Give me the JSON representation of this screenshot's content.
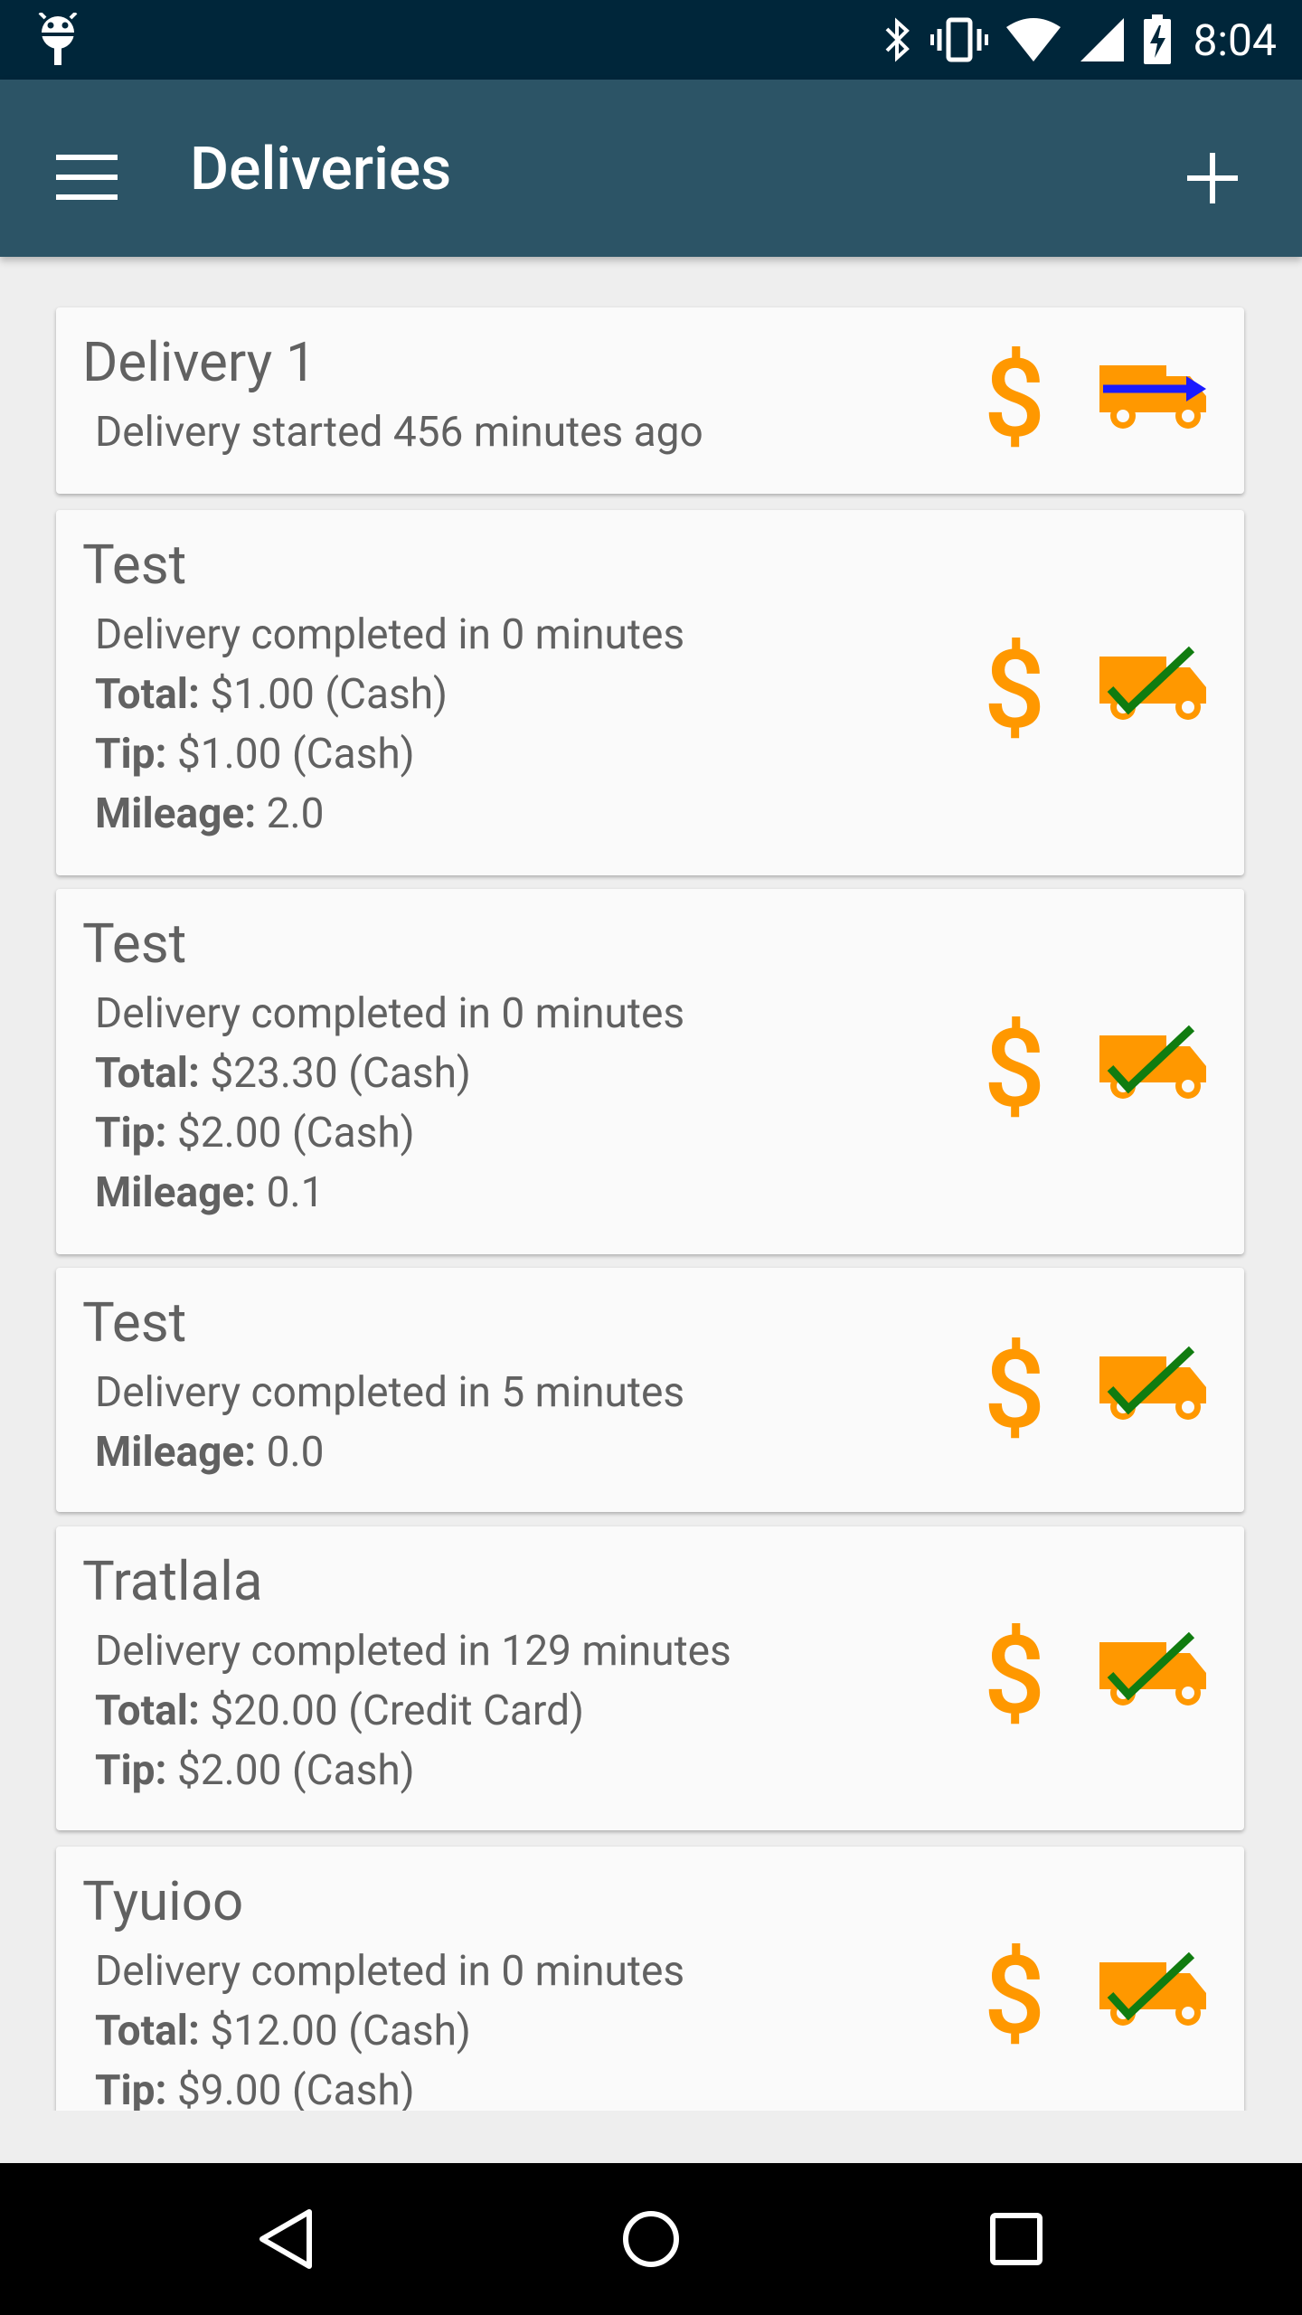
{
  "status_bar": {
    "time": "8:04",
    "icons": [
      "android-debug-icon",
      "bluetooth-icon",
      "vibrate-icon",
      "wifi-icon",
      "signal-icon",
      "battery-charging-icon"
    ]
  },
  "app_bar": {
    "title": "Deliveries",
    "menu_icon": "hamburger-menu-icon",
    "add_icon": "plus-icon"
  },
  "colors": {
    "status_bar": "#00263a",
    "app_bar": "#2c5466",
    "accent_orange": "#ff9800",
    "check_green": "#107c10",
    "arrow_blue": "#1a1aff",
    "card_background": "#fafafa"
  },
  "deliveries": [
    {
      "name": "Delivery 1",
      "status_line": "Delivery started 456 minutes ago",
      "details": [],
      "state": "in-progress",
      "payment_icon": "dollar-icon"
    },
    {
      "name": "Test",
      "status_line": "Delivery completed in 0 minutes",
      "details": [
        {
          "label": "Total:",
          "value": "$1.00 (Cash)"
        },
        {
          "label": "Tip:",
          "value": "$1.00 (Cash)"
        },
        {
          "label": "Mileage:",
          "value": "2.0"
        }
      ],
      "state": "completed",
      "payment_icon": "dollar-icon"
    },
    {
      "name": "Test",
      "status_line": "Delivery completed in 0 minutes",
      "details": [
        {
          "label": "Total:",
          "value": "$23.30 (Cash)"
        },
        {
          "label": "Tip:",
          "value": "$2.00 (Cash)"
        },
        {
          "label": "Mileage:",
          "value": "0.1"
        }
      ],
      "state": "completed",
      "payment_icon": "dollar-icon"
    },
    {
      "name": "Test",
      "status_line": "Delivery completed in 5 minutes",
      "details": [
        {
          "label": "Mileage:",
          "value": "0.0"
        }
      ],
      "state": "completed",
      "payment_icon": "dollar-icon"
    },
    {
      "name": "Tratlala",
      "status_line": "Delivery completed in 129 minutes",
      "details": [
        {
          "label": "Total:",
          "value": "$20.00 (Credit Card)"
        },
        {
          "label": "Tip:",
          "value": "$2.00 (Cash)"
        }
      ],
      "state": "completed",
      "payment_icon": "dollar-icon"
    },
    {
      "name": "Tyuioo",
      "status_line": "Delivery completed in 0 minutes",
      "details": [
        {
          "label": "Total:",
          "value": "$12.00 (Cash)"
        },
        {
          "label": "Tip:",
          "value": "$9.00 (Cash)"
        }
      ],
      "state": "completed",
      "payment_icon": "dollar-icon"
    }
  ],
  "nav_bar": {
    "buttons": [
      "back-icon",
      "home-icon",
      "recents-icon"
    ]
  }
}
